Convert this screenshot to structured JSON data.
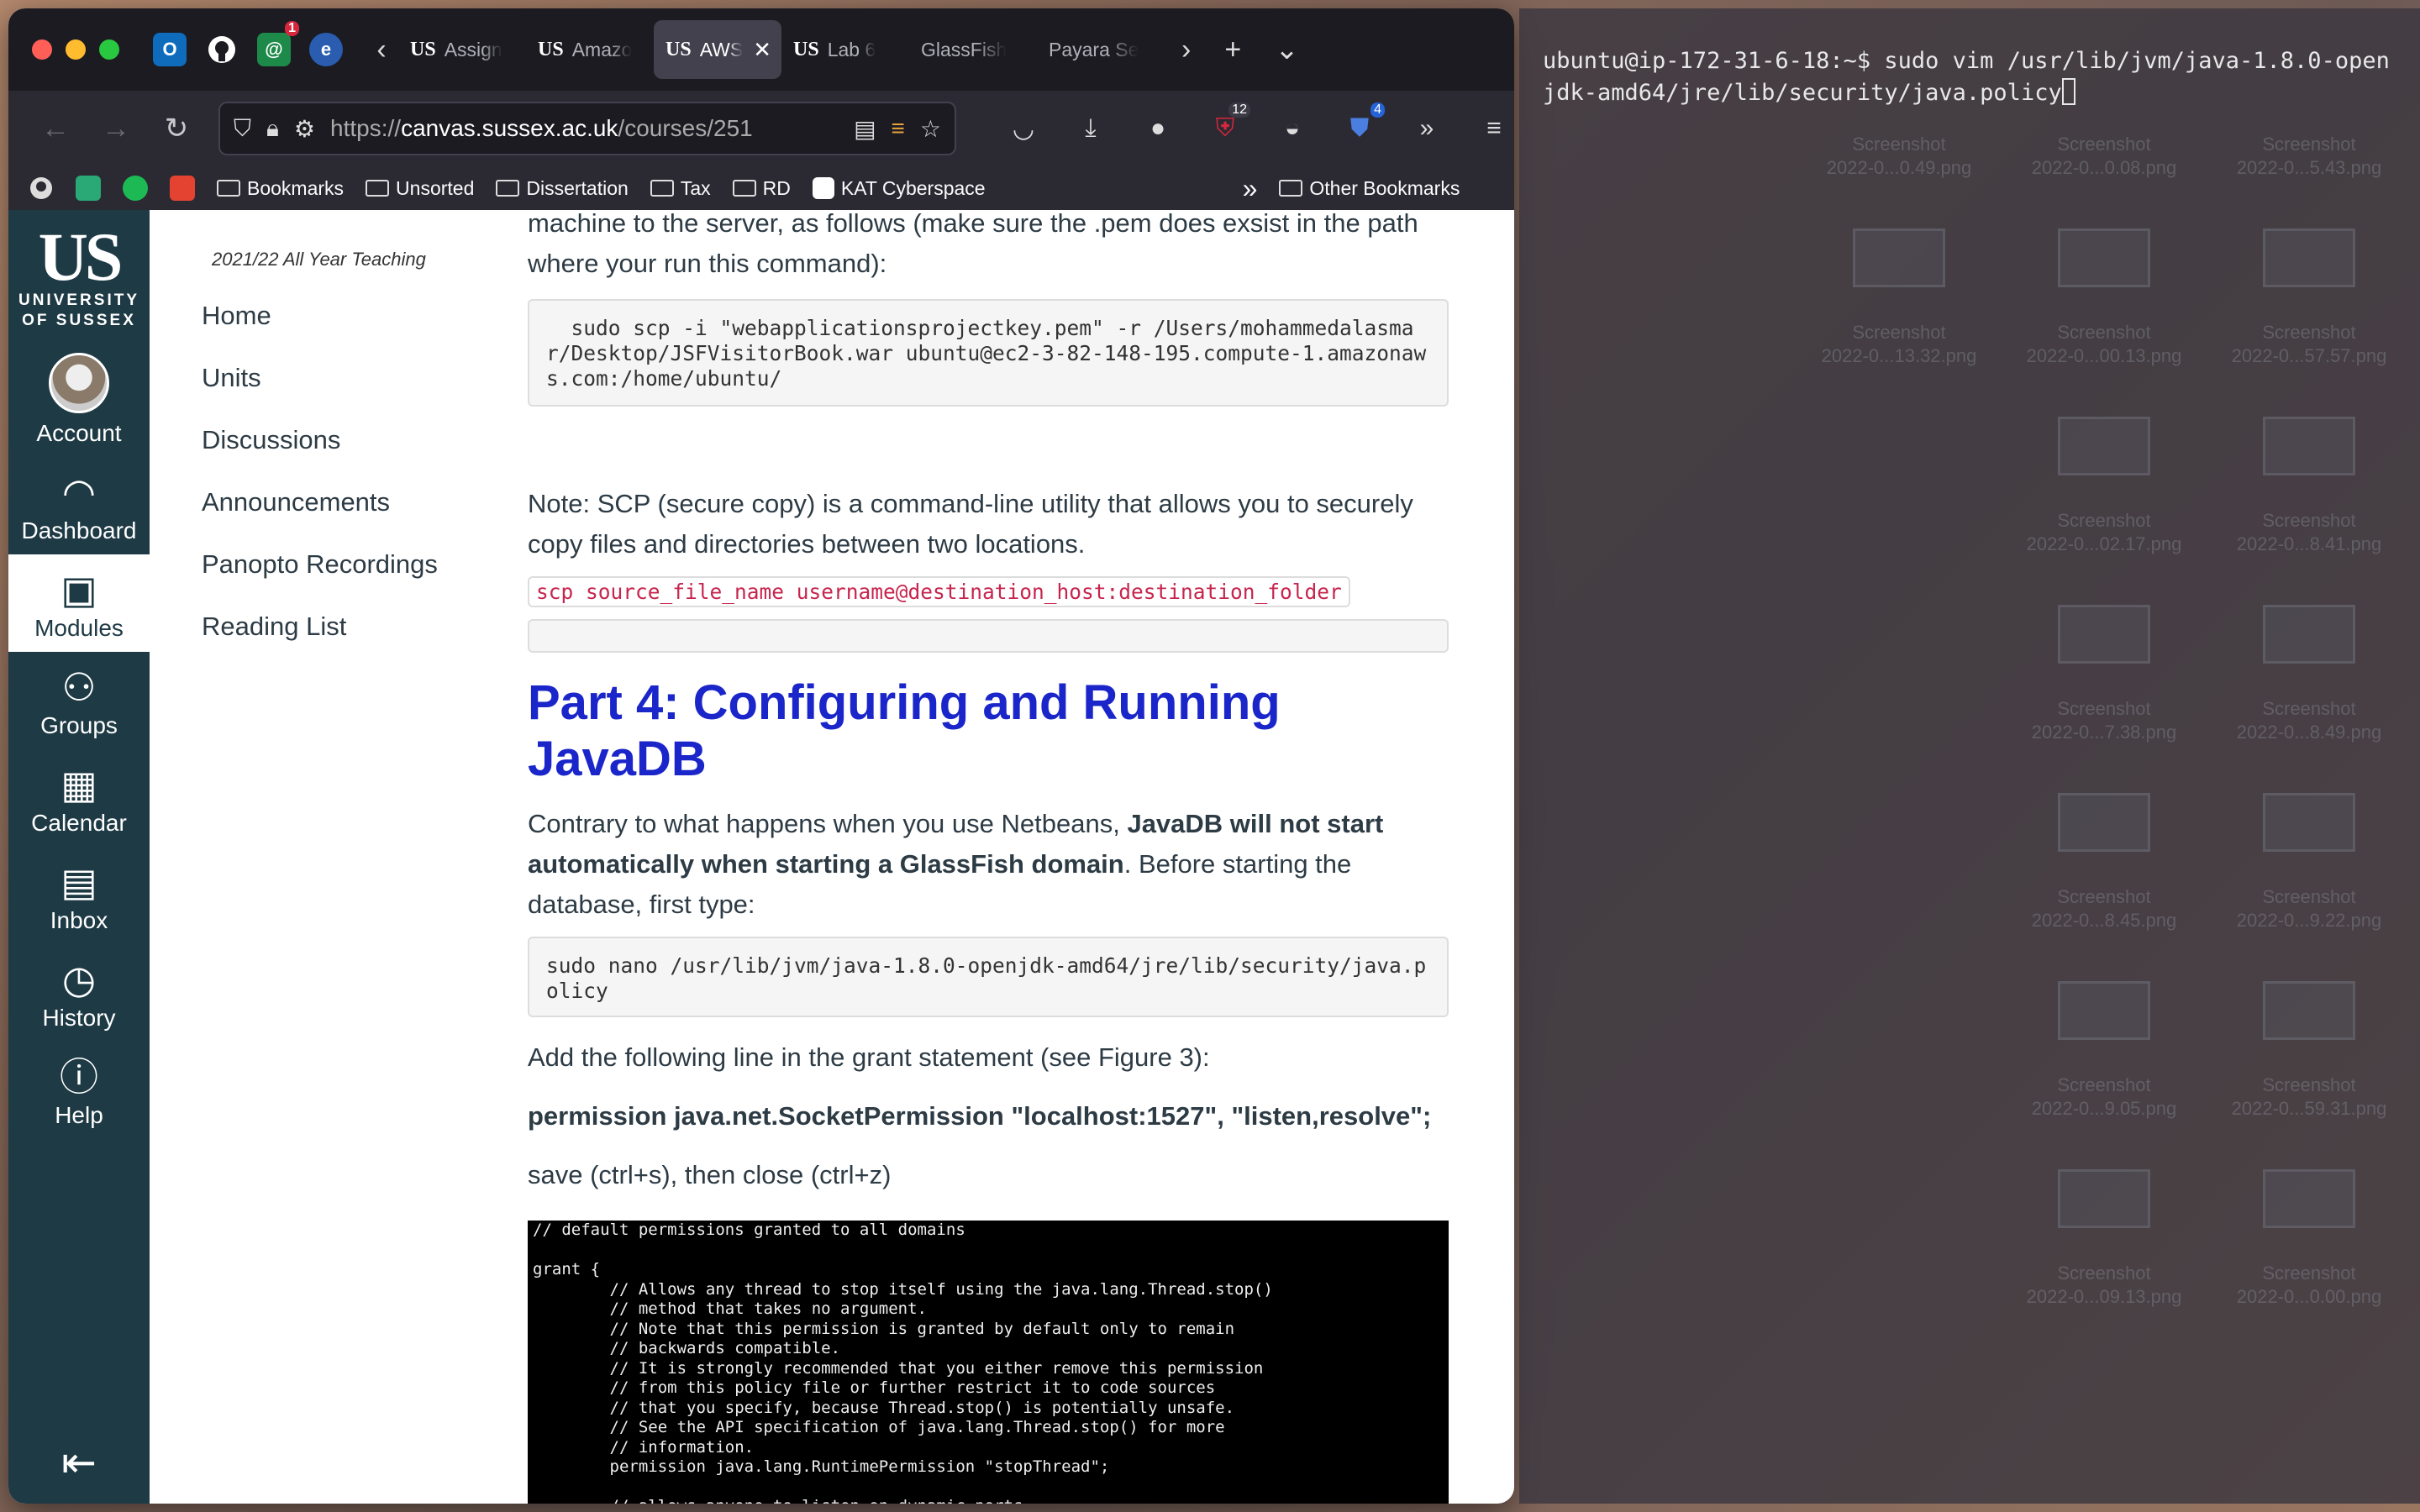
{
  "browser": {
    "tabs": [
      {
        "favicon": "US",
        "title": "Assign"
      },
      {
        "favicon": "US",
        "title": "Amazo"
      },
      {
        "favicon": "US",
        "title": "AWS",
        "active": true
      },
      {
        "favicon": "US",
        "title": "Lab 6"
      },
      {
        "favicon": "",
        "title": "GlassFish"
      },
      {
        "favicon": "",
        "title": "Payara Se"
      }
    ],
    "url_host": "canvas.sussex.ac.uk",
    "url_prefix": "https://",
    "url_suffix": "/courses/251",
    "badges": {
      "ublock": "12",
      "bitwarden": "4",
      "pinned_mail": "1"
    },
    "bookmarks": [
      "Bookmarks",
      "Unsorted",
      "Dissertation",
      "Tax",
      "RD",
      "KAT Cyberspace"
    ],
    "other_bookmarks": "Other Bookmarks"
  },
  "global_nav": {
    "logo_mark": "US",
    "logo_text_1": "UNIVERSITY",
    "logo_text_2": "OF SUSSEX",
    "items": [
      {
        "label": "Account",
        "icon": "avatar"
      },
      {
        "label": "Dashboard",
        "icon": "dashboard-icon"
      },
      {
        "label": "Modules",
        "icon": "modules-icon",
        "active": true
      },
      {
        "label": "Groups",
        "icon": "groups-icon"
      },
      {
        "label": "Calendar",
        "icon": "calendar-icon"
      },
      {
        "label": "Inbox",
        "icon": "inbox-icon"
      },
      {
        "label": "History",
        "icon": "history-icon"
      },
      {
        "label": "Help",
        "icon": "help-icon"
      }
    ]
  },
  "course_nav": {
    "term": "2021/22 All Year Teaching",
    "items": [
      "Home",
      "Units",
      "Discussions",
      "Announcements",
      "Panopto Recordings",
      "Reading List"
    ]
  },
  "main": {
    "p_intro": "machine to the server, as follows (make sure the .pem does exsist in the path where your run this command):",
    "scp_cmd": "  sudo scp -i \"webapplicationsprojectkey.pem\" -r /Users/mohammedalasmar/Desktop/JSFVisitorBook.war ubuntu@ec2-3-82-148-195.compute-1.amazonaws.com:/home/ubuntu/",
    "p_note": "Note: SCP (secure copy) is a command-line utility that allows you to securely copy files and directories between two locations.",
    "scp_syntax": "scp source_file_name username@destination_host:destination_folder",
    "heading": "Part 4: Configuring and Running JavaDB",
    "p_contrary_1": "Contrary to what happens when you use Netbeans, ",
    "p_contrary_bold": "JavaDB will not start automatically when starting a GlassFish domain",
    "p_contrary_2": ". Before starting the database, first type:",
    "nano_cmd": "sudo nano /usr/lib/jvm/java-1.8.0-openjdk-amd64/jre/lib/security/java.policy",
    "p_add": "Add the following line in the grant statement (see Figure 3):",
    "permission_line": "permission java.net.SocketPermission \"localhost:1527\", \"listen,resolve\";",
    "p_save": "save (ctrl+s), then close (ctrl+z)",
    "policy_lines": [
      "// default permissions granted to all domains",
      "",
      "grant {",
      "        // Allows any thread to stop itself using the java.lang.Thread.stop()",
      "        // method that takes no argument.",
      "        // Note that this permission is granted by default only to remain",
      "        // backwards compatible.",
      "        // It is strongly recommended that you either remove this permission",
      "        // from this policy file or further restrict it to code sources",
      "        // that you specify, because Thread.stop() is potentially unsafe.",
      "        // See the API specification of java.lang.Thread.stop() for more",
      "        // information.",
      "        permission java.lang.RuntimePermission \"stopThread\";",
      "",
      "        // allows anyone to listen on dynamic ports"
    ]
  },
  "terminal": {
    "prompt": "ubuntu@ip-172-31-6-18:~$ ",
    "command": "sudo vim /usr/lib/jvm/java-1.8.0-openjdk-amd64/jre/lib/security/java.policy"
  },
  "desktop_icons": [
    {
      "line1": "Screenshot",
      "line2": "2022-0...0.49.png"
    },
    {
      "line1": "Screenshot",
      "line2": "2022-0...0.08.png"
    },
    {
      "line1": "Screenshot",
      "line2": "2022-0...5.43.png"
    },
    {
      "line1": "Screenshot",
      "line2": "2022-0...13.32.png"
    },
    {
      "line1": "Screenshot",
      "line2": "2022-0...00.13.png"
    },
    {
      "line1": "Screenshot",
      "line2": "2022-0...57.57.png"
    },
    {
      "line1": "Screenshot",
      "line2": "2022-0...02.17.png"
    },
    {
      "line1": "Screenshot",
      "line2": "2022-0...8.41.png"
    },
    {
      "line1": "Screenshot",
      "line2": "2022-0...7.38.png"
    },
    {
      "line1": "Screenshot",
      "line2": "2022-0...8.49.png"
    },
    {
      "line1": "Screenshot",
      "line2": "2022-0...8.45.png"
    },
    {
      "line1": "Screenshot",
      "line2": "2022-0...9.22.png"
    },
    {
      "line1": "Screenshot",
      "line2": "2022-0...9.05.png"
    },
    {
      "line1": "Screenshot",
      "line2": "2022-0...59.31.png"
    },
    {
      "line1": "Screenshot",
      "line2": "2022-0...09.13.png"
    },
    {
      "line1": "Screenshot",
      "line2": "2022-0...0.00.png"
    }
  ],
  "colors": {
    "canvas_nav": "#1e3a45",
    "heading_blue": "#1a26c9",
    "code_red": "#c7254e",
    "browser_dark": "#1c1b22"
  }
}
